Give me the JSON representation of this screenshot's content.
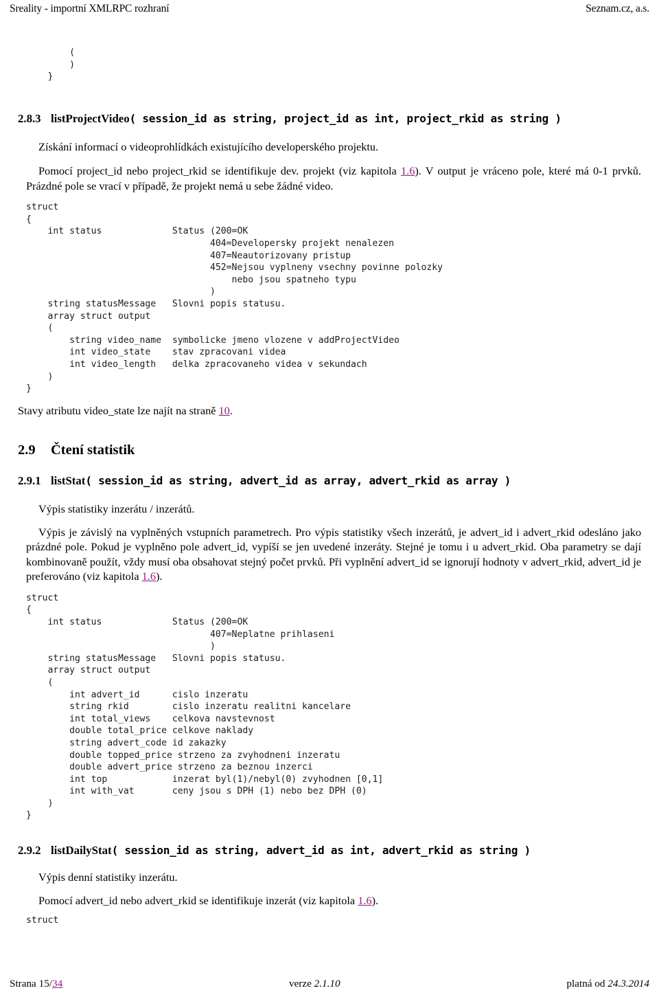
{
  "header": {
    "left": "Sreality - importní XMLRPC rozhraní",
    "right": "Seznam.cz, a.s."
  },
  "code_fragment_top": "        (\n        )\n    }",
  "sections": [
    {
      "number": "2.8.3",
      "title_name": "listProjectVideo",
      "title_signature": "( session_id as string, project_id as int, project_rkid as string )",
      "paragraph_1": "Získání informací o videoprohlídkách existujícího developerského projektu.",
      "paragraph_2_a": "Pomocí project_id nebo project_rkid se identifikuje dev. projekt (viz kapitola ",
      "paragraph_2_link": "1.6",
      "paragraph_2_b": "). V output je vráceno pole, které má 0-1 prvků. Prázdné pole se vrací v případě, že projekt nemá u sebe žádné video.",
      "code": "struct\n{\n    int status             Status (200=OK\n                                  404=Developersky projekt nenalezen\n                                  407=Neautorizovany pristup\n                                  452=Nejsou vyplneny vsechny povinne polozky\n                                      nebo jsou spatneho typu\n                                  )\n    string statusMessage   Slovni popis statusu.\n    array struct output\n    (\n        string video_name  symbolicke jmeno vlozene v addProjectVideo\n        int video_state    stav zpracovani videa\n        int video_length   delka zpracovaneho videa v sekundach\n    )\n}",
      "note_a": "Stavy atributu video_state lze najít na straně ",
      "note_link": "10",
      "note_b": "."
    }
  ],
  "section_2_9": {
    "number": "2.9",
    "title": "Čtení statistik"
  },
  "section_2_9_1": {
    "number": "2.9.1",
    "title_name": "listStat",
    "title_signature": "( session_id as string, advert_id as array, advert_rkid as array )",
    "paragraph_1": "Výpis statistiky inzerátu / inzerátů.",
    "paragraph_2_a": "Výpis je závislý na vyplněných vstupních parametrech.  Pro výpis statistiky všech inzerátů, je advert_id i advert_rkid odesláno jako prázdné pole.  Pokud je vyplněno pole advert_id, vypíší se jen uvedené inzeráty.  Stejné je tomu i u advert_rkid. Oba parametry se dají kombinovaně použít, vždy musí oba obsahovat stejný počet prvků.  Při vyplnění advert_id se ignorují hodnoty v advert_rkid, advert_id je preferováno (viz kapitola ",
    "paragraph_2_link": "1.6",
    "paragraph_2_b": ").",
    "code": "struct\n{\n    int status             Status (200=OK\n                                  407=Neplatne prihlaseni\n                                  )\n    string statusMessage   Slovni popis statusu.\n    array struct output\n    (\n        int advert_id      cislo inzeratu\n        string rkid        cislo inzeratu realitni kancelare\n        int total_views    celkova navstevnost\n        double total_price celkove naklady\n        string advert_code id zakazky\n        double topped_price strzeno za zvyhodneni inzeratu\n        double advert_price strzeno za beznou inzerci\n        int top            inzerat byl(1)/nebyl(0) zvyhodnen [0,1]\n        int with_vat       ceny jsou s DPH (1) nebo bez DPH (0)\n    )\n}"
  },
  "section_2_9_2": {
    "number": "2.9.2",
    "title_name": "listDailyStat",
    "title_signature": "( session_id as string, advert_id as int, advert_rkid as string )",
    "paragraph_1": "Výpis denní statistiky inzerátu.",
    "paragraph_2_a": "Pomocí advert_id nebo advert_rkid se identifikuje inzerát (viz kapitola ",
    "paragraph_2_link": "1.6",
    "paragraph_2_b": ").",
    "code": "struct"
  },
  "footer": {
    "left_prefix": "Strana 15/",
    "left_link": "34",
    "middle_prefix": "verze ",
    "middle_value": "2.1.10",
    "right_prefix": "platná od ",
    "right_value": "24.3.2014"
  },
  "colors": {
    "link": "#a0118a",
    "text": "#000000",
    "code": "#1b1b1b",
    "background": "#ffffff"
  }
}
